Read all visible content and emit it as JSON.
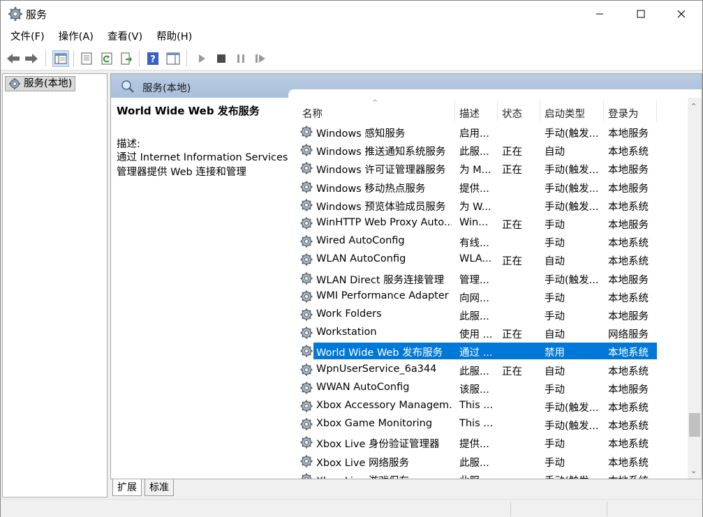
{
  "window": {
    "title": "服务",
    "icon": "gear-icon",
    "buttons": [
      "minimize-icon",
      "maximize-icon",
      "close-icon"
    ]
  },
  "menu": {
    "items": [
      "文件(F)",
      "操作(A)",
      "查看(V)",
      "帮助(H)"
    ]
  },
  "toolbar": {
    "icons": [
      "back-icon",
      "forward-icon",
      "show-hide-tree-icon",
      "properties-icon",
      "refresh-icon",
      "export-list-icon",
      "help-icon",
      "action-pane-icon",
      "start-service-icon",
      "stop-service-icon",
      "pause-service-icon",
      "restart-service-icon"
    ]
  },
  "tree": {
    "root_label": "服务(本地)"
  },
  "right_pane": {
    "header_title": "服务(本地)",
    "selected_service_name": "World Wide Web 发布服务",
    "desc_label": "描述:",
    "desc_line1": "通过 Internet Information Services",
    "desc_line2": "管理器提供 Web 连接和管理"
  },
  "list": {
    "columns": [
      "名称",
      "描述",
      "状态",
      "启动类型",
      "登录为"
    ],
    "rows": [
      {
        "name": "Windows 感知服务",
        "desc": "启用...",
        "state": "",
        "stype": "手动(触发...",
        "logon": "本地服务"
      },
      {
        "name": "Windows 推送通知系统服务",
        "desc": "此服...",
        "state": "正在",
        "stype": "自动",
        "logon": "本地系统"
      },
      {
        "name": "Windows 许可证管理器服务",
        "desc": "为 M...",
        "state": "正在",
        "stype": "手动(触发...",
        "logon": "本地服务"
      },
      {
        "name": "Windows 移动热点服务",
        "desc": "提供...",
        "state": "",
        "stype": "手动(触发...",
        "logon": "本地服务"
      },
      {
        "name": "Windows 预览体验成员服务",
        "desc": "为 W...",
        "state": "",
        "stype": "手动(触发...",
        "logon": "本地系统"
      },
      {
        "name": "WinHTTP Web Proxy Auto...",
        "desc": "Win...",
        "state": "正在",
        "stype": "手动",
        "logon": "本地服务"
      },
      {
        "name": "Wired AutoConfig",
        "desc": "有线...",
        "state": "",
        "stype": "手动",
        "logon": "本地系统"
      },
      {
        "name": "WLAN AutoConfig",
        "desc": "WLA...",
        "state": "正在",
        "stype": "自动",
        "logon": "本地系统"
      },
      {
        "name": "WLAN Direct 服务连接管理",
        "desc": "管理...",
        "state": "",
        "stype": "手动(触发...",
        "logon": "本地服务"
      },
      {
        "name": "WMI Performance Adapter",
        "desc": "向网...",
        "state": "",
        "stype": "手动",
        "logon": "本地系统"
      },
      {
        "name": "Work Folders",
        "desc": "此服...",
        "state": "",
        "stype": "手动",
        "logon": "本地服务"
      },
      {
        "name": "Workstation",
        "desc": "使用 ...",
        "state": "正在",
        "stype": "自动",
        "logon": "网络服务"
      },
      {
        "name": "World Wide Web 发布服务",
        "desc": "通过 ...",
        "state": "",
        "stype": "禁用",
        "logon": "本地系统",
        "selected": true
      },
      {
        "name": "WpnUserService_6a344",
        "desc": "此服...",
        "state": "正在",
        "stype": "自动",
        "logon": "本地系统"
      },
      {
        "name": "WWAN AutoConfig",
        "desc": "该服...",
        "state": "",
        "stype": "手动",
        "logon": "本地服务"
      },
      {
        "name": "Xbox Accessory Managem...",
        "desc": "This ...",
        "state": "",
        "stype": "手动(触发...",
        "logon": "本地系统"
      },
      {
        "name": "Xbox Game Monitoring",
        "desc": "This ...",
        "state": "",
        "stype": "手动(触发...",
        "logon": "本地系统"
      },
      {
        "name": "Xbox Live 身份验证管理器",
        "desc": "提供...",
        "state": "",
        "stype": "手动",
        "logon": "本地系统"
      },
      {
        "name": "Xbox Live 网络服务",
        "desc": "此服...",
        "state": "",
        "stype": "手动",
        "logon": "本地系统"
      },
      {
        "name": "Xbox Live 游戏保存",
        "desc": "此服...",
        "state": "",
        "stype": "手动(触发...",
        "logon": "本地系统"
      }
    ]
  },
  "bottom_tabs": {
    "extended": "扩展",
    "standard": "标准"
  },
  "colors": {
    "selection": "#0078d7",
    "header_band": "#b9cce2"
  }
}
